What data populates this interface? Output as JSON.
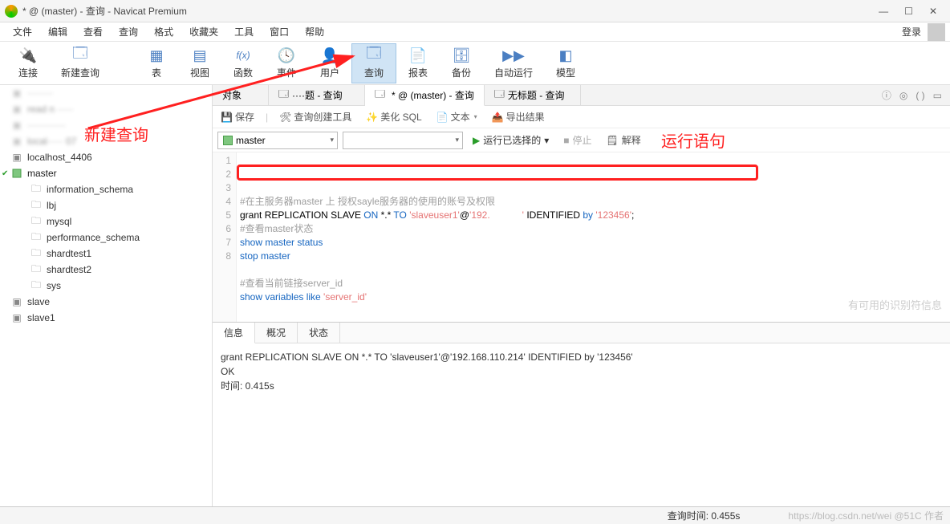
{
  "window": {
    "title": "* @ (master) - 查询 - Navicat Premium"
  },
  "menu": {
    "items": [
      "文件",
      "编辑",
      "查看",
      "查询",
      "格式",
      "收藏夹",
      "工具",
      "窗口",
      "帮助"
    ],
    "login": "登录"
  },
  "toolbar": {
    "items": [
      {
        "label": "连接",
        "icon": "plug-icon"
      },
      {
        "label": "新建查询",
        "icon": "new-query-icon"
      },
      {
        "label": "表",
        "icon": "table-icon"
      },
      {
        "label": "视图",
        "icon": "view-icon"
      },
      {
        "label": "函数",
        "icon": "fx-icon"
      },
      {
        "label": "事件",
        "icon": "clock-icon"
      },
      {
        "label": "用户",
        "icon": "user-icon"
      },
      {
        "label": "查询",
        "icon": "query-icon",
        "active": true
      },
      {
        "label": "报表",
        "icon": "report-icon"
      },
      {
        "label": "备份",
        "icon": "backup-icon"
      },
      {
        "label": "自动运行",
        "icon": "auto-icon"
      },
      {
        "label": "模型",
        "icon": "model-icon"
      }
    ]
  },
  "annotations": {
    "new_query": "新建查询",
    "run_stmt": "运行语句"
  },
  "sidebar": {
    "items": [
      {
        "name": "localhost_4406",
        "icon": "db-grey",
        "indent": 0
      },
      {
        "name": "master",
        "icon": "db-green",
        "indent": 0,
        "expanded": true,
        "checked": true
      },
      {
        "name": "information_schema",
        "icon": "dbitem",
        "indent": 1
      },
      {
        "name": "lbj",
        "icon": "dbitem",
        "indent": 1
      },
      {
        "name": "mysql",
        "icon": "dbitem",
        "indent": 1
      },
      {
        "name": "performance_schema",
        "icon": "dbitem",
        "indent": 1
      },
      {
        "name": "shardtest1",
        "icon": "dbitem",
        "indent": 1
      },
      {
        "name": "shardtest2",
        "icon": "dbitem",
        "indent": 1
      },
      {
        "name": "sys",
        "icon": "dbitem",
        "indent": 1
      },
      {
        "name": "slave",
        "icon": "db-grey",
        "indent": 0
      },
      {
        "name": "slave1",
        "icon": "db-grey",
        "indent": 0
      }
    ]
  },
  "tabs": {
    "list": [
      {
        "label": "对象"
      },
      {
        "label": "····题 - 查询",
        "icon": "query-icon"
      },
      {
        "label": "* @ (master) - 查询",
        "icon": "query-icon",
        "dirty": true,
        "active": true
      },
      {
        "label": "无标题 - 查询",
        "icon": "query-icon"
      }
    ]
  },
  "query_toolbar1": {
    "save": "保存",
    "builder": "查询创建工具",
    "beautify": "美化 SQL",
    "text": "文本",
    "export": "导出结果"
  },
  "query_toolbar2": {
    "connection": "master",
    "database_placeholder": "",
    "run_selected": "运行已选择的",
    "stop": "停止",
    "explain": "解释"
  },
  "editor": {
    "lines": [
      {
        "n": 1,
        "type": "cmt",
        "text": "#在主服务器master 上 授权sayle服务器的使用的账号及权限"
      },
      {
        "n": 2,
        "type": "sql",
        "tokens": [
          "grant",
          " REPLICATION SLAVE ",
          {
            "kw": "ON"
          },
          " *.* ",
          {
            "kw": "TO"
          },
          " ",
          {
            "str": "'slaveuser1'"
          },
          "@",
          {
            "str": "'192.            '"
          },
          " IDENTIFIED ",
          {
            "kw": "by"
          },
          " ",
          {
            "str": "'123456'"
          },
          ";"
        ]
      },
      {
        "n": 3,
        "type": "cmt",
        "text": "#查看master状态"
      },
      {
        "n": 4,
        "type": "sql",
        "tokens": [
          {
            "kw": "show master status"
          }
        ]
      },
      {
        "n": 5,
        "type": "sql",
        "tokens": [
          {
            "kw": "stop master"
          }
        ]
      },
      {
        "n": 6,
        "type": "blank",
        "text": ""
      },
      {
        "n": 7,
        "type": "cmt",
        "text": "#查看当前链接server_id"
      },
      {
        "n": 8,
        "type": "sql",
        "tokens": [
          {
            "kw": "show variables like "
          },
          {
            "str": "'server_id'"
          }
        ]
      }
    ],
    "watermark": "有可用的识别符信息"
  },
  "results": {
    "tabs": [
      "信息",
      "概况",
      "状态"
    ],
    "active_tab": 0,
    "lines": [
      "grant REPLICATION SLAVE ON *.* TO 'slaveuser1'@'192.168.110.214' IDENTIFIED by '123456'",
      "OK",
      "时间: 0.415s"
    ]
  },
  "statusbar": {
    "query_time": "查询时间: 0.455s",
    "watermark": "https://blog.csdn.net/wei  @51C  作者"
  }
}
